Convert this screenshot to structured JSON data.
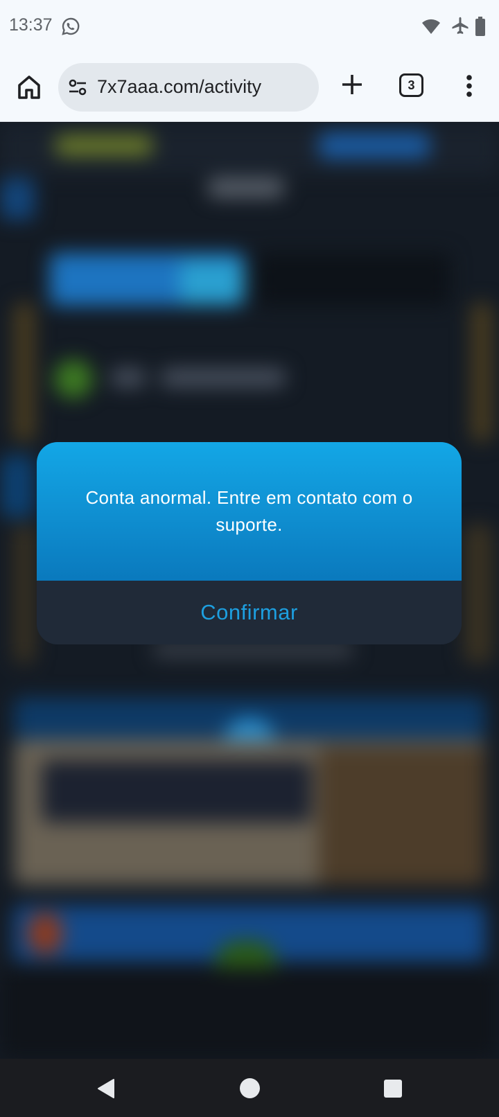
{
  "status_bar": {
    "time": "13:37",
    "icons": [
      "whatsapp-icon",
      "wifi-icon",
      "airplane-mode-icon",
      "battery-icon"
    ]
  },
  "browser": {
    "url": "7x7aaa.com/activity",
    "tab_count": "3",
    "icons": [
      "home-icon",
      "site-settings-icon",
      "new-tab-icon",
      "tab-switcher-icon",
      "more-vert-icon"
    ]
  },
  "dialog": {
    "message": "Conta anormal. Entre em contato com o suporte.",
    "confirm_label": "Confirmar",
    "colors": {
      "header_gradient_top": "#13a7e6",
      "header_gradient_bottom": "#0a79bd",
      "footer_bg": "#202a38",
      "confirm_text": "#1d9fe0"
    }
  },
  "navigation_bar": {
    "icons": [
      "back-icon",
      "home-circle-icon",
      "recents-icon"
    ]
  }
}
